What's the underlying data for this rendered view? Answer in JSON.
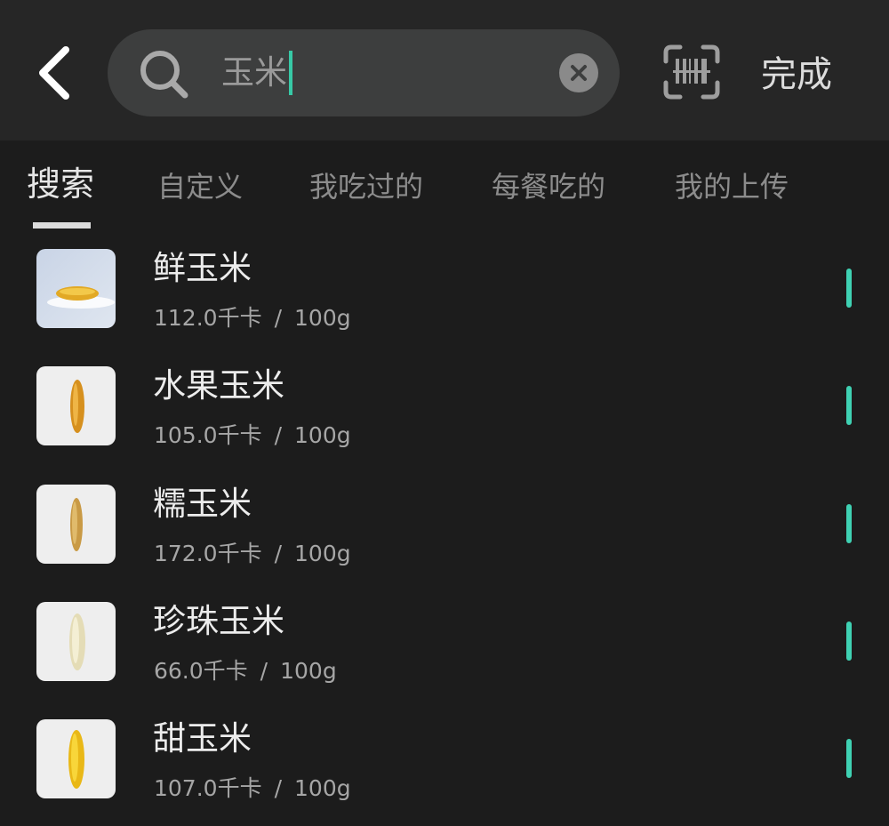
{
  "header": {
    "search_value": "玉米",
    "done_label": "完成",
    "icons": {
      "back": "chevron-left-icon",
      "search": "search-icon",
      "clear": "clear-icon",
      "scan": "barcode-scan-icon"
    }
  },
  "tabs": [
    {
      "label": "搜索",
      "active": true
    },
    {
      "label": "自定义",
      "active": false
    },
    {
      "label": "我吃过的",
      "active": false
    },
    {
      "label": "每餐吃的",
      "active": false
    },
    {
      "label": "我的上传",
      "active": false
    }
  ],
  "foods": [
    {
      "name": "鲜玉米",
      "calories": "112.0千卡",
      "separator": "/",
      "unit": "100g"
    },
    {
      "name": "水果玉米",
      "calories": "105.0千卡",
      "separator": "/",
      "unit": "100g"
    },
    {
      "name": "糯玉米",
      "calories": "172.0千卡",
      "separator": "/",
      "unit": "100g"
    },
    {
      "name": "珍珠玉米",
      "calories": "66.0千卡",
      "separator": "/",
      "unit": "100g"
    },
    {
      "name": "甜玉米",
      "calories": "107.0千卡",
      "separator": "/",
      "unit": "100g"
    }
  ],
  "colors": {
    "background": "#1c1c1c",
    "header": "#262626",
    "accent": "#3fd1b3"
  }
}
